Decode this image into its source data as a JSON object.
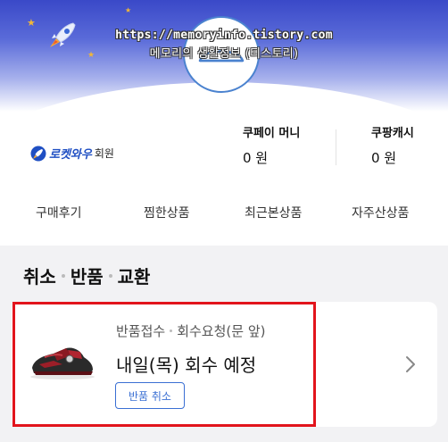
{
  "watermark": {
    "line1": "https://memoryinfo.tistory.com",
    "line2": "메모리의 생활정보 (티스토리)"
  },
  "membership": {
    "brand": "로켓와우",
    "suffix": "회원"
  },
  "wallet": [
    {
      "label": "쿠페이 머니",
      "value": "0 원"
    },
    {
      "label": "쿠팡캐시",
      "value": "0 원"
    }
  ],
  "tabs": [
    "구매후기",
    "찜한상품",
    "최근본상품",
    "자주산상품"
  ],
  "section": {
    "parts": [
      "취소",
      "반품",
      "교환"
    ]
  },
  "order_card": {
    "status_main": "반품접수",
    "status_sub": "회수요청(문 앞)",
    "headline": "내일(목) 회수 예정",
    "cancel_label": "반품 취소"
  },
  "colors": {
    "accent_blue": "#3a6fd3",
    "highlight_red": "#e2141c",
    "banner_blue": "#3a49c8"
  }
}
